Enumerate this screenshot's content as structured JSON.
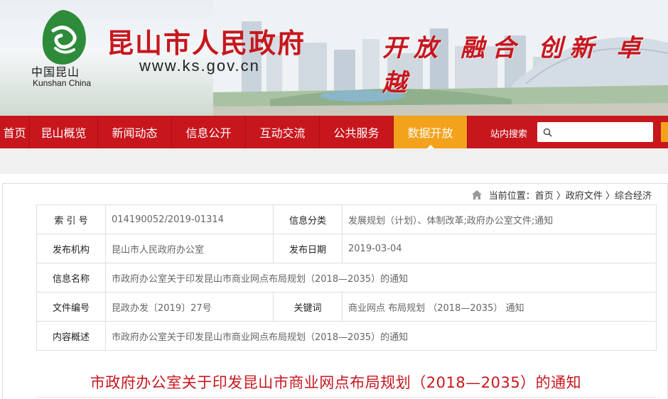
{
  "header": {
    "logo_cn": "中国昆山",
    "logo_en": "Kunshan China",
    "site_title": "昆山市人民政府",
    "site_url": "www.ks.gov.cn",
    "slogan": "开放 融合 创新 卓越"
  },
  "nav": {
    "items": [
      {
        "label": "首页"
      },
      {
        "label": "昆山概览"
      },
      {
        "label": "新闻动态"
      },
      {
        "label": "信息公开"
      },
      {
        "label": "互动交流"
      },
      {
        "label": "公共服务"
      },
      {
        "label": "数据开放"
      }
    ],
    "active_index": 6,
    "search_label": "站内搜索",
    "search_placeholder": ""
  },
  "breadcrumb": {
    "prefix": "当前位置：",
    "path": "首页 〉政府文件 〉综合经济"
  },
  "meta": {
    "row1": {
      "k1": "索 引 号",
      "v1": "014190052/2019-01314",
      "k2": "信息分类",
      "v2": "发展规划（计划）、体制改革;政府办公室文件;通知"
    },
    "row2": {
      "k1": "发布机构",
      "v1": "昆山市人民政府办公室",
      "k2": "发布日期",
      "v2": "2019-03-04"
    },
    "row3": {
      "k1": "信息名称",
      "v1": "市政府办公室关于印发昆山市商业网点布局规划（2018—2035）的通知"
    },
    "row4": {
      "k1": "文件编号",
      "v1": "昆政办发〔2019〕27号",
      "k2": "关键词",
      "v2": "商业网点 布局规划 （2018—2035） 通知"
    },
    "row5": {
      "k1": "内容概述",
      "v1": "市政府办公室关于印发昆山市商业网点布局规划（2018—2035）的通知"
    }
  },
  "document": {
    "title": "市政府办公室关于印发昆山市商业网点布局规划（2018—2035）的通知"
  },
  "colors": {
    "brand_red": "#c8161d",
    "active_orange": "#f3a21b"
  }
}
